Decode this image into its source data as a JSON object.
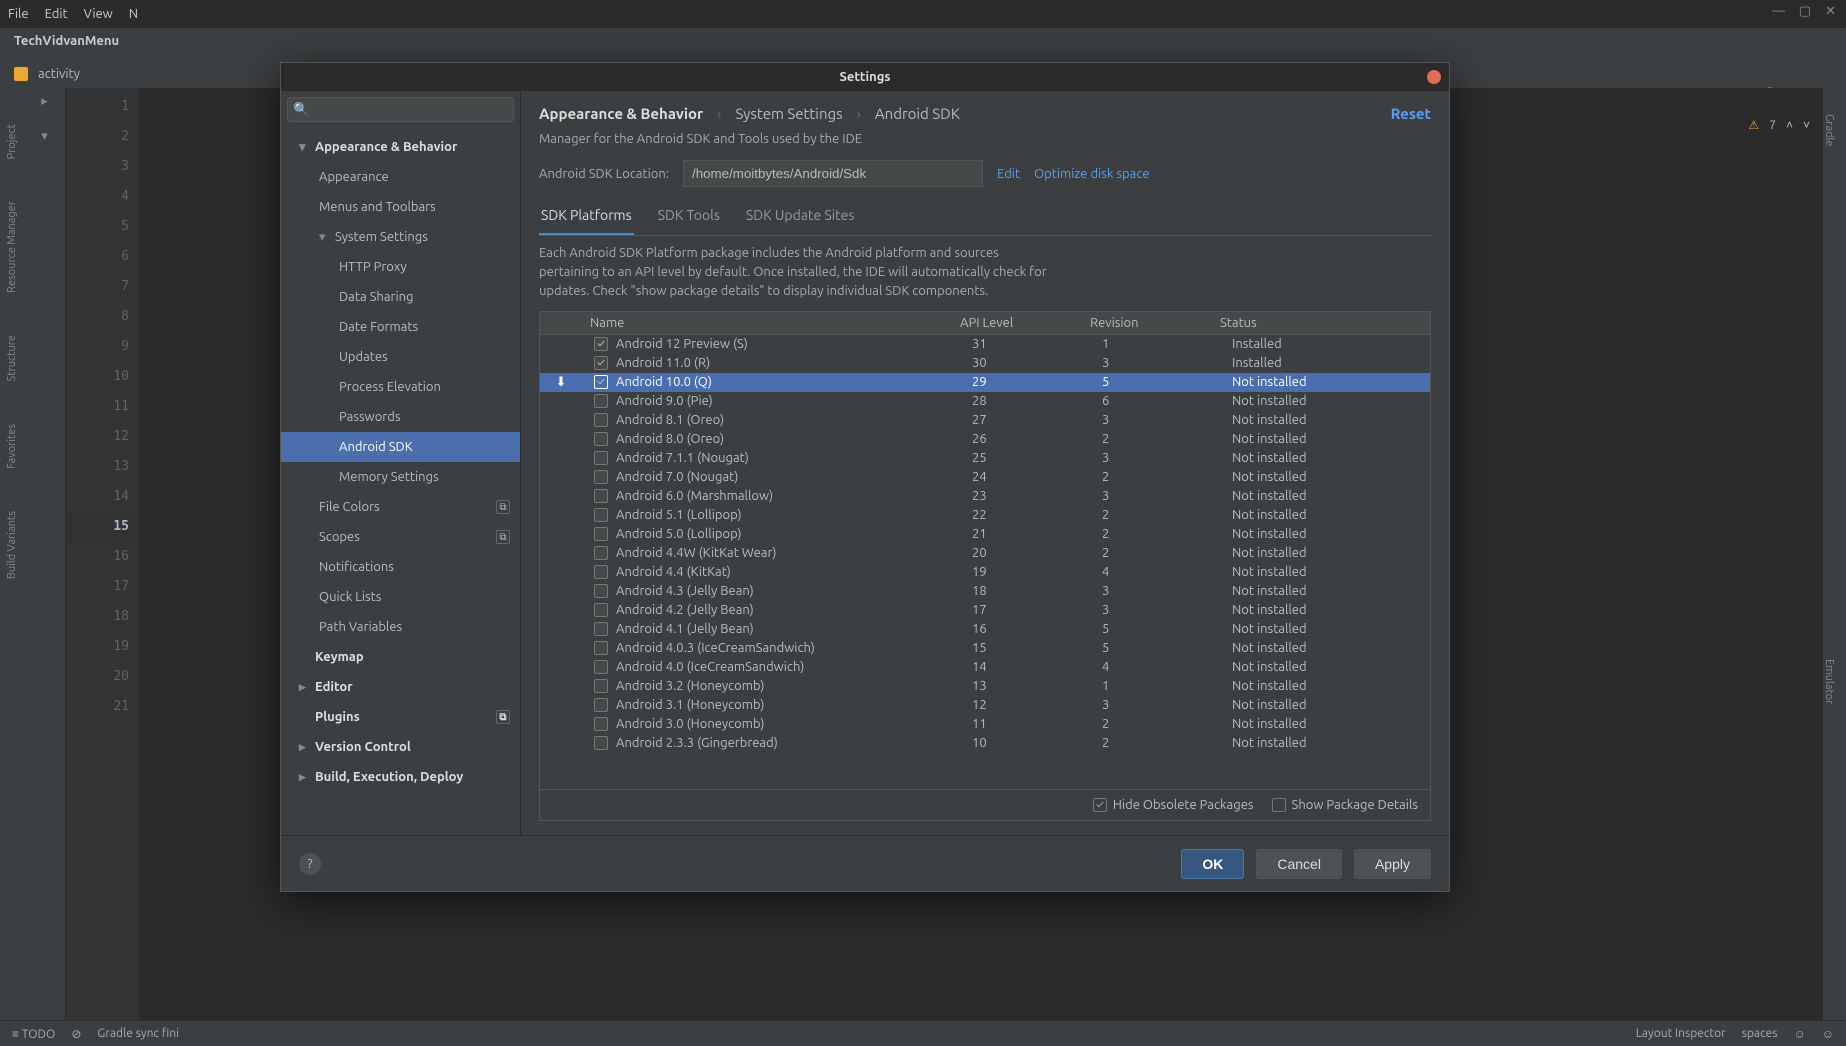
{
  "os_menu": [
    "File",
    "Edit",
    "View",
    "N"
  ],
  "ide": {
    "project_title": "TechVidvanMenu",
    "tab_label": "activity",
    "right_notif": {
      "warn_count": "7"
    },
    "status_left": [
      "TODO"
    ],
    "status_right": [
      "Layout Inspector",
      "spaces"
    ],
    "gradle_sync": "Gradle sync fini",
    "left_tools": [
      "Project",
      "Resource Manager",
      "Structure",
      "Favorites",
      "Build Variants"
    ],
    "right_tools": [
      "Gradle",
      "Emulator"
    ]
  },
  "dialog": {
    "title": "Settings",
    "search_placeholder": "",
    "tree": [
      {
        "label": "Appearance & Behavior",
        "level": 1,
        "chev": "▾"
      },
      {
        "label": "Appearance",
        "level": 2
      },
      {
        "label": "Menus and Toolbars",
        "level": 2
      },
      {
        "label": "System Settings",
        "level": 2,
        "chev": "▾"
      },
      {
        "label": "HTTP Proxy",
        "level": 3
      },
      {
        "label": "Data Sharing",
        "level": 3
      },
      {
        "label": "Date Formats",
        "level": 3
      },
      {
        "label": "Updates",
        "level": 3
      },
      {
        "label": "Process Elevation",
        "level": 3
      },
      {
        "label": "Passwords",
        "level": 3
      },
      {
        "label": "Android SDK",
        "level": 3,
        "selected": true
      },
      {
        "label": "Memory Settings",
        "level": 3
      },
      {
        "label": "File Colors",
        "level": 2,
        "badge": true
      },
      {
        "label": "Scopes",
        "level": 2,
        "badge": true
      },
      {
        "label": "Notifications",
        "level": 2
      },
      {
        "label": "Quick Lists",
        "level": 2
      },
      {
        "label": "Path Variables",
        "level": 2
      },
      {
        "label": "Keymap",
        "level": 1
      },
      {
        "label": "Editor",
        "level": 1,
        "chev": "▸"
      },
      {
        "label": "Plugins",
        "level": 1,
        "badge": true
      },
      {
        "label": "Version Control",
        "level": 1,
        "chev": "▸"
      },
      {
        "label": "Build, Execution, Deploy",
        "level": 1,
        "chev": "▸"
      }
    ],
    "breadcrumb": [
      "Appearance & Behavior",
      "System Settings",
      "Android SDK"
    ],
    "reset_label": "Reset",
    "subtitle": "Manager for the Android SDK and Tools used by the IDE",
    "sdk_location_label": "Android SDK Location:",
    "sdk_location_value": "/home/moitbytes/Android/Sdk",
    "edit_link": "Edit",
    "optimize_link": "Optimize disk space",
    "tabs": [
      "SDK Platforms",
      "SDK Tools",
      "SDK Update Sites"
    ],
    "active_tab": 0,
    "tab_desc": "Each Android SDK Platform package includes the Android platform and sources pertaining to an API level by default. Once installed, the IDE will automatically check for updates. Check \"show package details\" to display individual SDK components.",
    "columns": [
      "Name",
      "API Level",
      "Revision",
      "Status"
    ],
    "rows": [
      {
        "checked": true,
        "name": "Android 12 Preview (S)",
        "api": "31",
        "rev": "1",
        "status": "Installed"
      },
      {
        "checked": true,
        "name": "Android 11.0 (R)",
        "api": "30",
        "rev": "3",
        "status": "Installed"
      },
      {
        "checked": true,
        "selected": true,
        "dl": true,
        "name": "Android 10.0 (Q)",
        "api": "29",
        "rev": "5",
        "status": "Not installed"
      },
      {
        "checked": false,
        "name": "Android 9.0 (Pie)",
        "api": "28",
        "rev": "6",
        "status": "Not installed"
      },
      {
        "checked": false,
        "name": "Android 8.1 (Oreo)",
        "api": "27",
        "rev": "3",
        "status": "Not installed"
      },
      {
        "checked": false,
        "name": "Android 8.0 (Oreo)",
        "api": "26",
        "rev": "2",
        "status": "Not installed"
      },
      {
        "checked": false,
        "name": "Android 7.1.1 (Nougat)",
        "api": "25",
        "rev": "3",
        "status": "Not installed"
      },
      {
        "checked": false,
        "name": "Android 7.0 (Nougat)",
        "api": "24",
        "rev": "2",
        "status": "Not installed"
      },
      {
        "checked": false,
        "name": "Android 6.0 (Marshmallow)",
        "api": "23",
        "rev": "3",
        "status": "Not installed"
      },
      {
        "checked": false,
        "name": "Android 5.1 (Lollipop)",
        "api": "22",
        "rev": "2",
        "status": "Not installed"
      },
      {
        "checked": false,
        "name": "Android 5.0 (Lollipop)",
        "api": "21",
        "rev": "2",
        "status": "Not installed"
      },
      {
        "checked": false,
        "name": "Android 4.4W (KitKat Wear)",
        "api": "20",
        "rev": "2",
        "status": "Not installed"
      },
      {
        "checked": false,
        "name": "Android 4.4 (KitKat)",
        "api": "19",
        "rev": "4",
        "status": "Not installed"
      },
      {
        "checked": false,
        "name": "Android 4.3 (Jelly Bean)",
        "api": "18",
        "rev": "3",
        "status": "Not installed"
      },
      {
        "checked": false,
        "name": "Android 4.2 (Jelly Bean)",
        "api": "17",
        "rev": "3",
        "status": "Not installed"
      },
      {
        "checked": false,
        "name": "Android 4.1 (Jelly Bean)",
        "api": "16",
        "rev": "5",
        "status": "Not installed"
      },
      {
        "checked": false,
        "name": "Android 4.0.3 (IceCreamSandwich)",
        "api": "15",
        "rev": "5",
        "status": "Not installed"
      },
      {
        "checked": false,
        "name": "Android 4.0 (IceCreamSandwich)",
        "api": "14",
        "rev": "4",
        "status": "Not installed"
      },
      {
        "checked": false,
        "name": "Android 3.2 (Honeycomb)",
        "api": "13",
        "rev": "1",
        "status": "Not installed"
      },
      {
        "checked": false,
        "name": "Android 3.1 (Honeycomb)",
        "api": "12",
        "rev": "3",
        "status": "Not installed"
      },
      {
        "checked": false,
        "name": "Android 3.0 (Honeycomb)",
        "api": "11",
        "rev": "2",
        "status": "Not installed"
      },
      {
        "checked": false,
        "name": "Android 2.3.3 (Gingerbread)",
        "api": "10",
        "rev": "2",
        "status": "Not installed"
      }
    ],
    "hide_obsolete_label": "Hide Obsolete Packages",
    "hide_obsolete_checked": true,
    "show_details_label": "Show Package Details",
    "show_details_checked": false,
    "buttons": {
      "ok": "OK",
      "cancel": "Cancel",
      "apply": "Apply"
    }
  }
}
